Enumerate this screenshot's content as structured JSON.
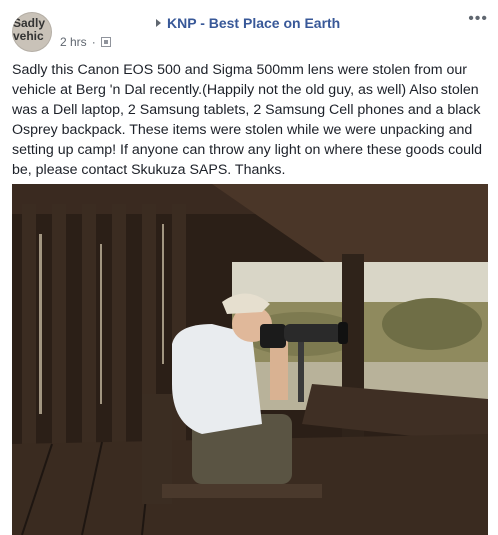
{
  "avatar": {
    "label": "Sadly vehic"
  },
  "header": {
    "group_name": "KNP - Best Place on Earth",
    "time": "2 hrs",
    "dot": "·"
  },
  "post": {
    "text": "Sadly this Canon EOS 500 and Sigma 500mm lens were stolen from our vehicle at Berg 'n Dal recently.(Happily not the old guy, as well) Also stolen was a Dell laptop, 2 Samsung tablets, 2 Samsung Cell phones and a black Osprey backpack. These items were stolen while we were unpacking and setting up camp! If anyone can throw any light on where these goods could be, please contact Skukuza SAPS. Thanks."
  },
  "icons": {
    "group_arrow": "caret-right-icon",
    "privacy": "group-privacy-icon",
    "more": "more-options-icon"
  },
  "colors": {
    "link": "#385898",
    "meta": "#606770"
  }
}
